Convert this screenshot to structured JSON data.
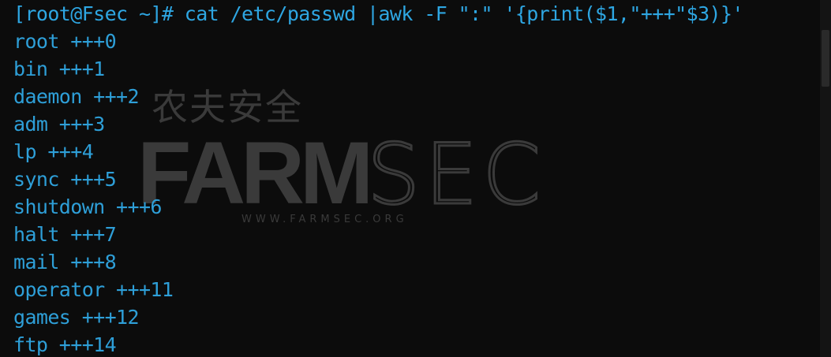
{
  "terminal": {
    "lines": [
      "[root@Fsec ~]# cat /etc/passwd |awk -F \":\" '{print($1,\"+++\"$3)}'",
      "root +++0",
      "bin +++1",
      "daemon +++2",
      "adm +++3",
      "lp +++4",
      "sync +++5",
      "shutdown +++6",
      "halt +++7",
      "mail +++8",
      "operator +++11",
      "games +++12",
      "ftp +++14"
    ]
  },
  "watermark": {
    "chinese": "农夫安全",
    "brand_bold": "FARM",
    "brand_light": "SEC",
    "url": "WWW.FARMSEC.ORG"
  },
  "colors": {
    "background": "#0c0c0c",
    "text": "#2e9fd8",
    "watermark": "#3a3a3a"
  }
}
